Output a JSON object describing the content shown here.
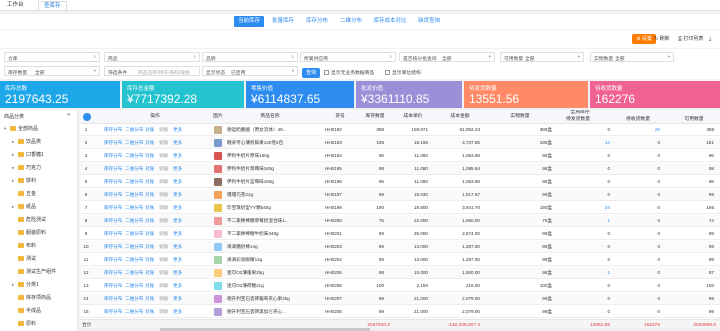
{
  "top_tabs": [
    {
      "label": "工作台",
      "active": false
    },
    {
      "label": "查库存",
      "active": true
    }
  ],
  "sub_tabs": [
    {
      "label": "当前库存",
      "active": true
    },
    {
      "label": "批量库存",
      "active": false
    },
    {
      "label": "库存分布",
      "active": false
    },
    {
      "label": "二维分布",
      "active": false
    },
    {
      "label": "库存成本对比",
      "active": false
    },
    {
      "label": "缺货查询",
      "active": false
    }
  ],
  "toolbar": {
    "settings_label": "设置",
    "refresh_label": "刷新",
    "print_label": "打印列表",
    "export_label": "导出"
  },
  "filters": {
    "warehouse": {
      "label": "仓库",
      "placeholder": ""
    },
    "product": {
      "label": "商品",
      "placeholder": ""
    },
    "brand": {
      "label": "品牌",
      "placeholder": ""
    },
    "supplier": {
      "label": "所属供应商",
      "placeholder": ""
    },
    "show_batch": {
      "label": "是否按分批查询",
      "value": "全部"
    },
    "available_qty": {
      "label": "可用数量",
      "value": "全部"
    },
    "actual_qty": {
      "label": "实物数量",
      "value": "全部"
    },
    "stock_qty": {
      "label": "库存数量",
      "value": "全部"
    },
    "filter_cond": {
      "label": "筛选条件",
      "placeholder": "商品名称/拼号/条码/规格"
    },
    "show_status": {
      "label": "显示状态",
      "value": "已启用"
    },
    "query_label": "查询",
    "chk_no_stock": "显示无业务数据商品",
    "chk_sub": "显示库位结构"
  },
  "cards": [
    {
      "title": "库存总数",
      "value": "2197643.25",
      "color": "#1ea7e8"
    },
    {
      "title": "库存总金额",
      "value": "¥7717392.28",
      "color": "#23c3d0"
    },
    {
      "title": "零售价值",
      "value": "¥6114837.65",
      "color": "#2d8cf0"
    },
    {
      "title": "批发价值",
      "value": "¥3361110.85",
      "color": "#9b8fd8"
    },
    {
      "title": "待发货数量",
      "value": "13551.56",
      "color": "#ff8a65"
    },
    {
      "title": "待收货数量",
      "value": "162276",
      "color": "#f06292"
    }
  ],
  "sidebar": {
    "title": "商品分类",
    "collapse_glyph": "«",
    "items": [
      {
        "label": "全部商品",
        "level": 0,
        "twisty": "▾"
      },
      {
        "label": "饮品类",
        "level": 1,
        "twisty": "▸"
      },
      {
        "label": "口香糖1",
        "level": 1,
        "twisty": "▸"
      },
      {
        "label": "巧克力",
        "level": 1,
        "twisty": "▸"
      },
      {
        "label": "饼利",
        "level": 1,
        "twisty": "▸"
      },
      {
        "label": "五金",
        "level": 1,
        "twisty": ""
      },
      {
        "label": "纸品",
        "level": 1,
        "twisty": "▸"
      },
      {
        "label": "危险测试",
        "level": 1,
        "twisty": ""
      },
      {
        "label": "服装原料",
        "level": 1,
        "twisty": ""
      },
      {
        "label": "布料",
        "level": 1,
        "twisty": ""
      },
      {
        "label": "测试",
        "level": 1,
        "twisty": ""
      },
      {
        "label": "测试生产组件",
        "level": 1,
        "twisty": ""
      },
      {
        "label": "分类1",
        "level": 1,
        "twisty": "▸"
      },
      {
        "label": "库存项商品",
        "level": 1,
        "twisty": ""
      },
      {
        "label": "半成品",
        "level": 1,
        "twisty": ""
      },
      {
        "label": "原料",
        "level": 1,
        "twisty": ""
      }
    ]
  },
  "grid": {
    "headers": {
      "op": "操作",
      "img": "图片",
      "name": "商品名称",
      "code": "货号",
      "stock": "库存数量",
      "cost_price": "成本单价",
      "cost_amount": "成本金额",
      "actual_qty": "实物数量",
      "group": "全局库存",
      "wait_ship": "待发货数量",
      "wait_recv": "待收货数量",
      "avail": "可用数量"
    },
    "op_links": [
      "库存分布",
      "二维分布",
      "对账",
      "调拨",
      "更多"
    ],
    "rows": [
      {
        "idx": "1",
        "name": "德运奶酪酸（原女流体）48...",
        "code": "HH0192",
        "stock": "388",
        "cost_price": "159.671",
        "cost_amount": "61,952.23",
        "actual": "388盒",
        "wait_ship": "0",
        "wait_recv": "20",
        "avail": "388",
        "color": "#c9b28a",
        "blue_ship": false,
        "blue_recv": true
      },
      {
        "idx": "2",
        "name": "糖朵专心薄煎鲜果140克5包",
        "code": "HH0193",
        "stock": "195",
        "cost_price": "19.168",
        "cost_amount": "3,737.85",
        "actual": "195盒",
        "wait_ship": "14",
        "wait_recv": "0",
        "avail": "181",
        "color": "#7a9ad0",
        "blue_ship": true,
        "blue_recv": false
      },
      {
        "idx": "3",
        "name": "伊利牛奶片原味160g",
        "code": "HH0194",
        "stock": "96",
        "cost_price": "11.080",
        "cost_amount": "1,063.68",
        "actual": "96盒",
        "wait_ship": "0",
        "wait_recv": "0",
        "avail": "96",
        "color": "#d9534f",
        "blue_ship": false,
        "blue_recv": false
      },
      {
        "idx": "4",
        "name": "伊利牛奶片草莓味160g",
        "code": "HH0195",
        "stock": "98",
        "cost_price": "11.080",
        "cost_amount": "1,085.84",
        "actual": "98盒",
        "wait_ship": "0",
        "wait_recv": "0",
        "avail": "98",
        "color": "#e57373",
        "blue_ship": false,
        "blue_recv": false
      },
      {
        "idx": "5",
        "name": "伊利牛奶片蓝莓味160g",
        "code": "HH0196",
        "stock": "96",
        "cost_price": "11.080",
        "cost_amount": "1,063.68",
        "actual": "96盒",
        "wait_ship": "0",
        "wait_recv": "0",
        "avail": "96",
        "color": "#8d6e63",
        "blue_ship": false,
        "blue_recv": false
      },
      {
        "idx": "6",
        "name": "嘎嘎巧克21g",
        "code": "HH0197",
        "stock": "99",
        "cost_price": "15.030",
        "cost_amount": "1,517.67",
        "actual": "99盒",
        "wait_ship": "0",
        "wait_recv": "0",
        "avail": "99",
        "color": "#f4a259",
        "blue_ship": false,
        "blue_recv": false
      },
      {
        "idx": "7",
        "name": "珍宝珠奶型YY糖540g",
        "code": "HH0199",
        "stock": "190",
        "cost_price": "19.800",
        "cost_amount": "3,641.70",
        "actual": "190盒",
        "wait_ship": "24",
        "wait_recv": "0",
        "avail": "166",
        "color": "#e8c547",
        "blue_ship": true,
        "blue_recv": false
      },
      {
        "idx": "8",
        "name": "不二家棒棒糖草莓奶混合味1...",
        "code": "HH0200",
        "stock": "75",
        "cost_price": "22.000",
        "cost_amount": "1,650.00",
        "actual": "75盒",
        "wait_ship": "1",
        "wait_recv": "0",
        "avail": "74",
        "color": "#ef9a9a",
        "blue_ship": true,
        "blue_recv": false
      },
      {
        "idx": "9",
        "name": "不二家棒棒糖牛奶味348g",
        "code": "HH0201",
        "stock": "99",
        "cost_price": "26,000",
        "cost_amount": "2,574.00",
        "actual": "99盒",
        "wait_ship": "0",
        "wait_recv": "0",
        "avail": "99",
        "color": "#f8bbd0",
        "blue_ship": false,
        "blue_recv": false
      },
      {
        "idx": "10",
        "name": "滴滴糖奶棒14g",
        "code": "HH0203",
        "stock": "99",
        "cost_price": "13.000",
        "cost_amount": "1,287.00",
        "actual": "99盒",
        "wait_ship": "0",
        "wait_recv": "0",
        "avail": "99",
        "color": "#90caf9",
        "blue_ship": false,
        "blue_recv": false
      },
      {
        "idx": "11",
        "name": "滴滴彩妆眼睛14g",
        "code": "HH0204",
        "stock": "99",
        "cost_price": "13.000",
        "cost_amount": "1,287.00",
        "actual": "99盒",
        "wait_ship": "0",
        "wait_recv": "0",
        "avail": "99",
        "color": "#a5d6a7",
        "blue_ship": false,
        "blue_recv": false
      },
      {
        "idx": "12",
        "name": "迷可O2薄菌果25g",
        "code": "HH0205",
        "stock": "98",
        "cost_price": "15.000",
        "cost_amount": "1,500.00",
        "actual": "98盒",
        "wait_ship": "1",
        "wait_recv": "0",
        "avail": "97",
        "color": "#ffcc80",
        "blue_ship": true,
        "blue_recv": false
      },
      {
        "idx": "13",
        "name": "迷可O2薄荷糖21g",
        "code": "HH0206",
        "stock": "100",
        "cost_price": "2.150",
        "cost_amount": "215.00",
        "actual": "100盒",
        "wait_ship": "0",
        "wait_recv": "0",
        "avail": "100",
        "color": "#80deea",
        "blue_ship": false,
        "blue_recv": false
      },
      {
        "idx": "14",
        "name": "德升利宝石瓷砖葡萄夹心果25g",
        "code": "HH0207",
        "stock": "99",
        "cost_price": "21.000",
        "cost_amount": "2,079.00",
        "actual": "99盒",
        "wait_ship": "0",
        "wait_recv": "0",
        "avail": "99",
        "color": "#ce93d8",
        "blue_ship": false,
        "blue_recv": false
      },
      {
        "idx": "15",
        "name": "德升利宝石瓷砖黑加仑夹心...",
        "code": "HH0208",
        "stock": "99",
        "cost_price": "21.000",
        "cost_amount": "2,079.00",
        "actual": "99盒",
        "wait_ship": "0",
        "wait_recv": "0",
        "avail": "99",
        "color": "#b39ddb",
        "blue_ship": false,
        "blue_recv": false
      }
    ],
    "footer": {
      "label": "合计",
      "stock": "2047520.2",
      "cost_amount": "-132,328,007.4",
      "wait_ship": "13551.56",
      "wait_recv": "162276",
      "avail": "2033968.6"
    }
  }
}
